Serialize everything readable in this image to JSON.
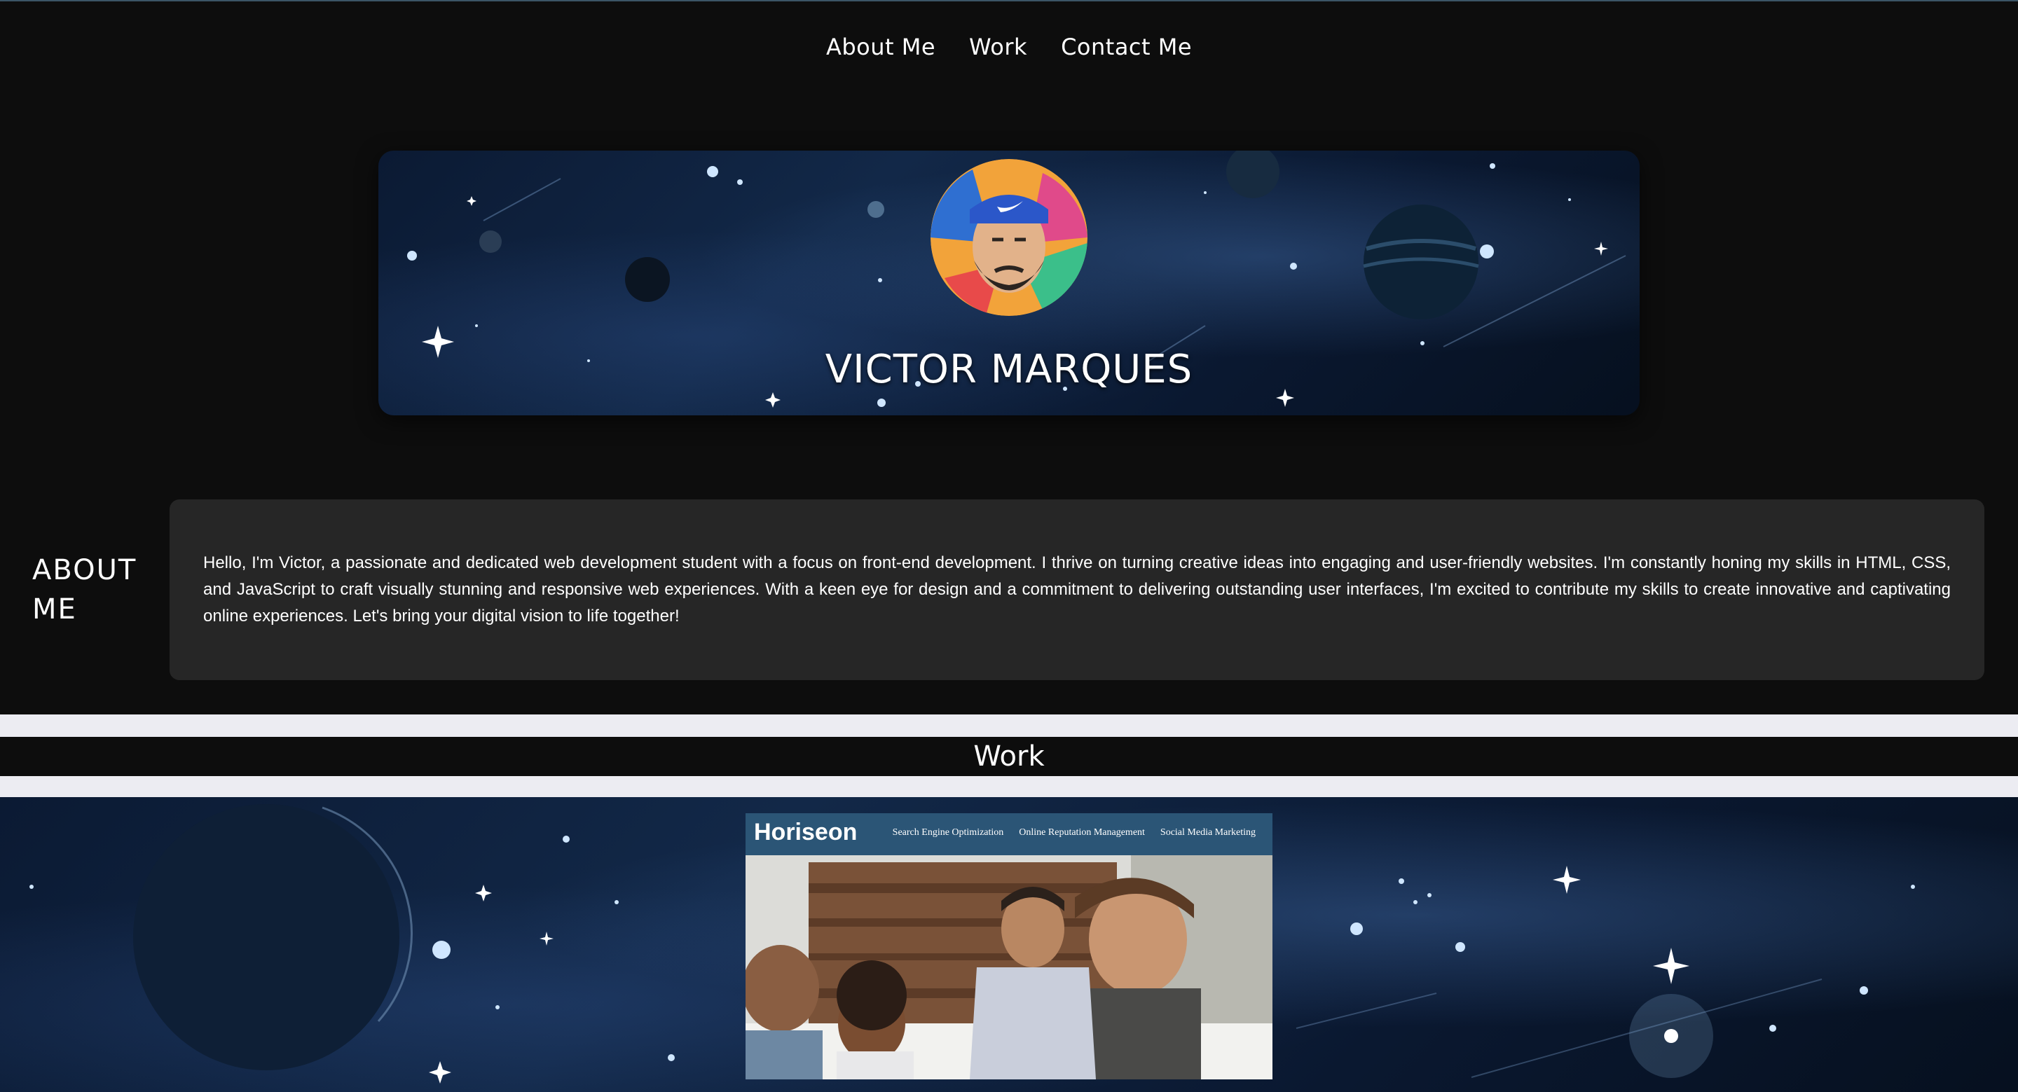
{
  "nav": {
    "items": [
      {
        "label": "About Me"
      },
      {
        "label": "Work"
      },
      {
        "label": "Contact Me"
      }
    ]
  },
  "hero": {
    "name": "VICTOR MARQUES",
    "avatar_icon": "person-avatar"
  },
  "about": {
    "heading": "ABOUT ME",
    "text": "Hello, I'm Victor, a passionate and dedicated web development student with a focus on front-end development. I thrive on turning creative ideas into engaging and user-friendly websites. I'm constantly honing my skills in HTML, CSS, and JavaScript to craft visually stunning and responsive web experiences. With a keen eye for design and a commitment to delivering outstanding user interfaces, I'm excited to contribute my skills to create innovative and captivating online experiences. Let's bring your digital vision to life together!"
  },
  "work": {
    "heading": "Work",
    "project": {
      "brand": "Horiseon",
      "nav": [
        "Search Engine Optimization",
        "Online Reputation Management",
        "Social Media Marketing"
      ]
    }
  },
  "colors": {
    "page_bg": "#0d0d0d",
    "card_bg": "#262626",
    "band_light": "#ececf2",
    "project_header": "#2b5576"
  }
}
